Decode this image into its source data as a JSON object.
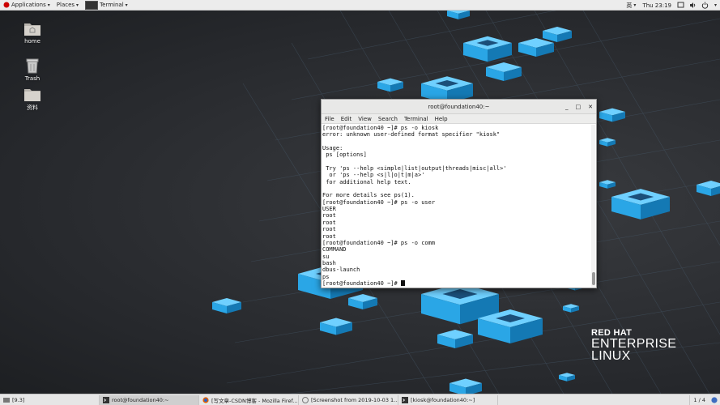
{
  "topbar": {
    "applications": "Applications",
    "places": "Places",
    "active_app": "Terminal",
    "input_method": "英",
    "clock": "Thu 23:19"
  },
  "desktop": {
    "icons": [
      {
        "label": "home"
      },
      {
        "label": "Trash"
      },
      {
        "label": "资料"
      }
    ],
    "logo": {
      "line1": "RED HAT",
      "line2": "ENTERPRISE",
      "line3": "LINUX"
    }
  },
  "terminal": {
    "title": "root@foundation40:~",
    "menu": [
      "File",
      "Edit",
      "View",
      "Search",
      "Terminal",
      "Help"
    ],
    "lines": [
      "[root@foundation40 ~]# ps -o kiosk",
      "error: unknown user-defined format specifier \"kiosk\"",
      "",
      "Usage:",
      " ps [options]",
      "",
      " Try 'ps --help <simple|list|output|threads|misc|all>'",
      "  or 'ps --help <s|l|o|t|m|a>'",
      " for additional help text.",
      "",
      "For more details see ps(1).",
      "[root@foundation40 ~]# ps -o user",
      "USER",
      "root",
      "root",
      "root",
      "root",
      "[root@foundation40 ~]# ps -o comm",
      "COMMAND",
      "su",
      "bash",
      "dbus-launch",
      "ps"
    ],
    "prompt": "[root@foundation40 ~]# "
  },
  "taskbar": {
    "tasks": [
      {
        "label": "[9.3]",
        "active": false
      },
      {
        "label": "root@foundation40:~",
        "active": true
      },
      {
        "label": "[写文章-CSDN博客 - Mozilla Firef...",
        "active": false
      },
      {
        "label": "[Screenshot from 2019-10-03 1...",
        "active": false
      },
      {
        "label": "[kiosk@foundation40:~]",
        "active": false
      }
    ],
    "workspace": "1 / 4"
  },
  "colors": {
    "cube": "#2aa6e6",
    "cube_dark": "#1479b4",
    "cube_light": "#6fd0ff"
  }
}
